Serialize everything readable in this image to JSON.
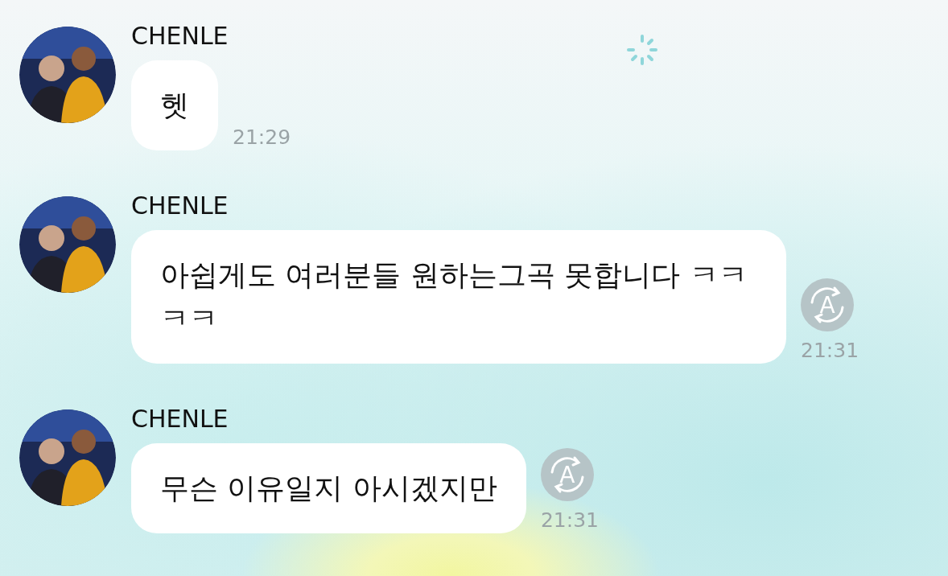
{
  "messages": [
    {
      "sender": "CHENLE",
      "text": "헷",
      "time": "21:29"
    },
    {
      "sender": "CHENLE",
      "text": "아쉽게도 여러분들 원하는그곡 못합니다 ㅋㅋㅋㅋ",
      "time": "21:31",
      "translate_label": "A"
    },
    {
      "sender": "CHENLE",
      "text": "무슨 이유일지 아시겠지만",
      "time": "21:31",
      "translate_label": "A"
    }
  ]
}
